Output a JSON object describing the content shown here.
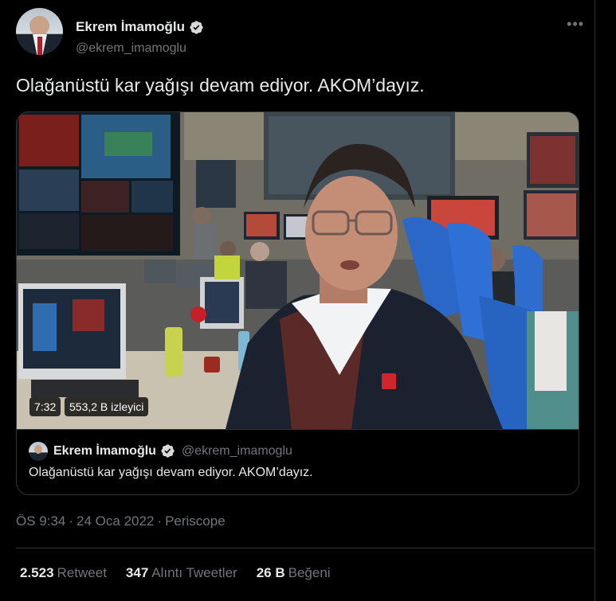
{
  "author": {
    "name": "Ekrem İmamoğlu",
    "handle": "@ekrem_imamoglu",
    "verified": true
  },
  "menu_icon": "more-horizontal-icon",
  "tweet": {
    "text": "Olağanüstü kar yağışı devam ediyor. AKOM’dayız."
  },
  "video": {
    "duration": "7:32",
    "views": "553,2 B izleyici"
  },
  "quoted": {
    "name": "Ekrem İmamoğlu",
    "handle": "@ekrem_imamoglu",
    "text": "Olağanüstü kar yağışı devam ediyor. AKOM’dayız."
  },
  "meta": {
    "time": "ÖS 9:34",
    "date": "24 Oca 2022",
    "source": "Periscope",
    "separator": "·"
  },
  "stats": [
    {
      "count": "2.523",
      "label": "Retweet"
    },
    {
      "count": "347",
      "label": "Alıntı Tweetler"
    },
    {
      "count": "26 B",
      "label": "Beğeni"
    }
  ],
  "colors": {
    "background": "#000000",
    "text": "#e7e9ea",
    "muted": "#71767b",
    "border": "#2f3336",
    "verified": "#d9d9d9"
  }
}
